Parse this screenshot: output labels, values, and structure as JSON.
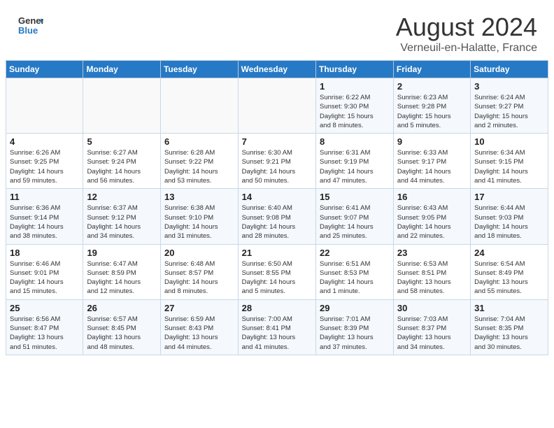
{
  "header": {
    "logo_line1": "General",
    "logo_line2": "Blue",
    "month": "August 2024",
    "location": "Verneuil-en-Halatte, France"
  },
  "weekdays": [
    "Sunday",
    "Monday",
    "Tuesday",
    "Wednesday",
    "Thursday",
    "Friday",
    "Saturday"
  ],
  "weeks": [
    [
      {
        "day": "",
        "info": ""
      },
      {
        "day": "",
        "info": ""
      },
      {
        "day": "",
        "info": ""
      },
      {
        "day": "",
        "info": ""
      },
      {
        "day": "1",
        "info": "Sunrise: 6:22 AM\nSunset: 9:30 PM\nDaylight: 15 hours\nand 8 minutes."
      },
      {
        "day": "2",
        "info": "Sunrise: 6:23 AM\nSunset: 9:28 PM\nDaylight: 15 hours\nand 5 minutes."
      },
      {
        "day": "3",
        "info": "Sunrise: 6:24 AM\nSunset: 9:27 PM\nDaylight: 15 hours\nand 2 minutes."
      }
    ],
    [
      {
        "day": "4",
        "info": "Sunrise: 6:26 AM\nSunset: 9:25 PM\nDaylight: 14 hours\nand 59 minutes."
      },
      {
        "day": "5",
        "info": "Sunrise: 6:27 AM\nSunset: 9:24 PM\nDaylight: 14 hours\nand 56 minutes."
      },
      {
        "day": "6",
        "info": "Sunrise: 6:28 AM\nSunset: 9:22 PM\nDaylight: 14 hours\nand 53 minutes."
      },
      {
        "day": "7",
        "info": "Sunrise: 6:30 AM\nSunset: 9:21 PM\nDaylight: 14 hours\nand 50 minutes."
      },
      {
        "day": "8",
        "info": "Sunrise: 6:31 AM\nSunset: 9:19 PM\nDaylight: 14 hours\nand 47 minutes."
      },
      {
        "day": "9",
        "info": "Sunrise: 6:33 AM\nSunset: 9:17 PM\nDaylight: 14 hours\nand 44 minutes."
      },
      {
        "day": "10",
        "info": "Sunrise: 6:34 AM\nSunset: 9:15 PM\nDaylight: 14 hours\nand 41 minutes."
      }
    ],
    [
      {
        "day": "11",
        "info": "Sunrise: 6:36 AM\nSunset: 9:14 PM\nDaylight: 14 hours\nand 38 minutes."
      },
      {
        "day": "12",
        "info": "Sunrise: 6:37 AM\nSunset: 9:12 PM\nDaylight: 14 hours\nand 34 minutes."
      },
      {
        "day": "13",
        "info": "Sunrise: 6:38 AM\nSunset: 9:10 PM\nDaylight: 14 hours\nand 31 minutes."
      },
      {
        "day": "14",
        "info": "Sunrise: 6:40 AM\nSunset: 9:08 PM\nDaylight: 14 hours\nand 28 minutes."
      },
      {
        "day": "15",
        "info": "Sunrise: 6:41 AM\nSunset: 9:07 PM\nDaylight: 14 hours\nand 25 minutes."
      },
      {
        "day": "16",
        "info": "Sunrise: 6:43 AM\nSunset: 9:05 PM\nDaylight: 14 hours\nand 22 minutes."
      },
      {
        "day": "17",
        "info": "Sunrise: 6:44 AM\nSunset: 9:03 PM\nDaylight: 14 hours\nand 18 minutes."
      }
    ],
    [
      {
        "day": "18",
        "info": "Sunrise: 6:46 AM\nSunset: 9:01 PM\nDaylight: 14 hours\nand 15 minutes."
      },
      {
        "day": "19",
        "info": "Sunrise: 6:47 AM\nSunset: 8:59 PM\nDaylight: 14 hours\nand 12 minutes."
      },
      {
        "day": "20",
        "info": "Sunrise: 6:48 AM\nSunset: 8:57 PM\nDaylight: 14 hours\nand 8 minutes."
      },
      {
        "day": "21",
        "info": "Sunrise: 6:50 AM\nSunset: 8:55 PM\nDaylight: 14 hours\nand 5 minutes."
      },
      {
        "day": "22",
        "info": "Sunrise: 6:51 AM\nSunset: 8:53 PM\nDaylight: 14 hours\nand 1 minute."
      },
      {
        "day": "23",
        "info": "Sunrise: 6:53 AM\nSunset: 8:51 PM\nDaylight: 13 hours\nand 58 minutes."
      },
      {
        "day": "24",
        "info": "Sunrise: 6:54 AM\nSunset: 8:49 PM\nDaylight: 13 hours\nand 55 minutes."
      }
    ],
    [
      {
        "day": "25",
        "info": "Sunrise: 6:56 AM\nSunset: 8:47 PM\nDaylight: 13 hours\nand 51 minutes."
      },
      {
        "day": "26",
        "info": "Sunrise: 6:57 AM\nSunset: 8:45 PM\nDaylight: 13 hours\nand 48 minutes."
      },
      {
        "day": "27",
        "info": "Sunrise: 6:59 AM\nSunset: 8:43 PM\nDaylight: 13 hours\nand 44 minutes."
      },
      {
        "day": "28",
        "info": "Sunrise: 7:00 AM\nSunset: 8:41 PM\nDaylight: 13 hours\nand 41 minutes."
      },
      {
        "day": "29",
        "info": "Sunrise: 7:01 AM\nSunset: 8:39 PM\nDaylight: 13 hours\nand 37 minutes."
      },
      {
        "day": "30",
        "info": "Sunrise: 7:03 AM\nSunset: 8:37 PM\nDaylight: 13 hours\nand 34 minutes."
      },
      {
        "day": "31",
        "info": "Sunrise: 7:04 AM\nSunset: 8:35 PM\nDaylight: 13 hours\nand 30 minutes."
      }
    ]
  ]
}
